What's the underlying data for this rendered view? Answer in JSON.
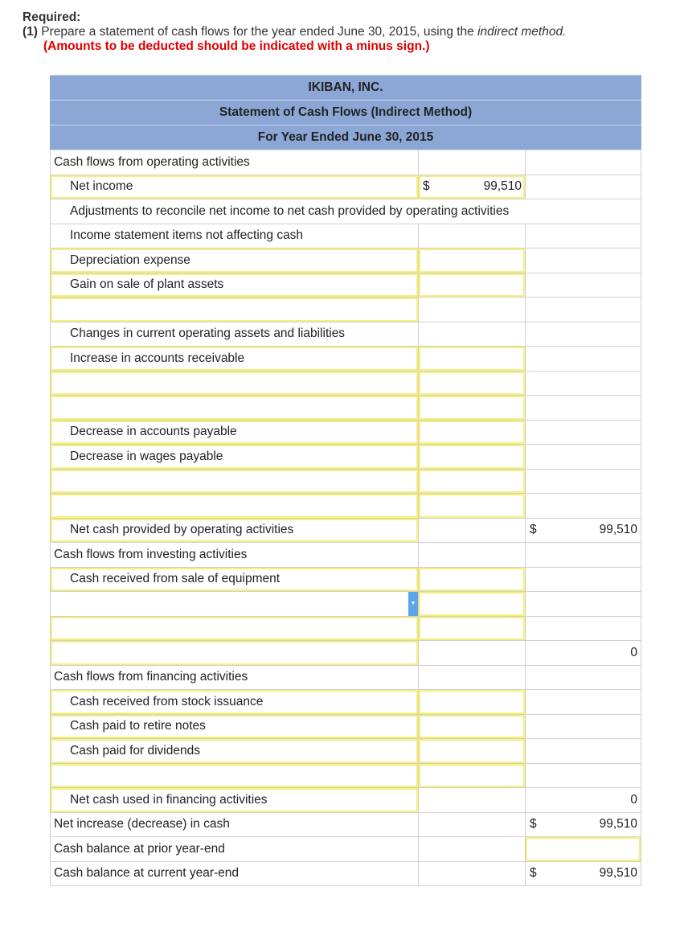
{
  "instructions": {
    "title": "Required:",
    "number": "(1)",
    "text_before": " Prepare a statement of cash flows for the year ended June 30, 2015, using the ",
    "text_italic": "indirect method.",
    "note": "(Amounts to be deducted should be indicated with a minus sign.)"
  },
  "statement": {
    "company": "IKIBAN, INC.",
    "title": "Statement of Cash Flows (Indirect Method)",
    "period": "For Year Ended June 30, 2015",
    "currency_symbol": "$",
    "rows": [
      {
        "label": "Cash flows from operating activities",
        "indent": false,
        "label_input": false,
        "col2": "",
        "col2_input": false,
        "col3": ""
      },
      {
        "label": "Net income",
        "indent": true,
        "label_input": true,
        "col2": "99,510",
        "col2_dollar": true,
        "col2_input": true,
        "col3": ""
      },
      {
        "label": "Adjustments to reconcile net income to net cash provided by operating activities",
        "indent": true,
        "span": true
      },
      {
        "label": "Income statement items not affecting cash",
        "indent": true,
        "label_input": false,
        "col2": "",
        "col2_input": false,
        "col3": ""
      },
      {
        "label": "Depreciation expense",
        "indent": true,
        "label_input": true,
        "col2": "",
        "col2_input": true,
        "col3": ""
      },
      {
        "label": "Gain on sale of plant assets",
        "indent": true,
        "label_input": true,
        "col2": "",
        "col2_input": true,
        "col3": ""
      },
      {
        "label": "",
        "indent": true,
        "label_input": true,
        "col2": "",
        "col2_input": false,
        "col3": ""
      },
      {
        "label": "Changes in current operating assets and liabilities",
        "indent": true,
        "label_input": false,
        "col2": "",
        "col2_input": false,
        "col3": ""
      },
      {
        "label": "Increase in accounts receivable",
        "indent": true,
        "label_input": true,
        "col2": "",
        "col2_input": true,
        "col3": ""
      },
      {
        "label": "",
        "indent": true,
        "label_input": true,
        "col2": "",
        "col2_input": true,
        "col3": ""
      },
      {
        "label": "",
        "indent": true,
        "label_input": true,
        "col2": "",
        "col2_input": true,
        "col3": ""
      },
      {
        "label": "Decrease in accounts payable",
        "indent": true,
        "label_input": true,
        "col2": "",
        "col2_input": true,
        "col3": ""
      },
      {
        "label": "Decrease in wages payable",
        "indent": true,
        "label_input": true,
        "col2": "",
        "col2_input": true,
        "col3": ""
      },
      {
        "label": "",
        "indent": true,
        "label_input": true,
        "col2": "",
        "col2_input": true,
        "col3": ""
      },
      {
        "label": "",
        "indent": true,
        "label_input": true,
        "col2": "",
        "col2_input": true,
        "col3": ""
      },
      {
        "label": "Net cash provided by operating activities",
        "indent": true,
        "label_input": true,
        "col2": "",
        "col2_input": false,
        "col2_topline": true,
        "col3": "99,510",
        "col3_dollar": true
      },
      {
        "label": "Cash flows from investing activities",
        "indent": false,
        "label_input": false,
        "col2": "",
        "col2_input": false,
        "col3": ""
      },
      {
        "label": "Cash received from sale of equipment",
        "indent": true,
        "label_input": true,
        "col2": "",
        "col2_input": true,
        "col3": ""
      },
      {
        "label": "",
        "indent": true,
        "label_input": true,
        "dropdown": true,
        "col2": "",
        "col2_input": true,
        "col3": ""
      },
      {
        "label": "",
        "indent": true,
        "label_input": true,
        "col2": "",
        "col2_input": true,
        "col3": ""
      },
      {
        "label": "",
        "indent": true,
        "label_input": true,
        "col2": "",
        "col2_input": false,
        "col2_topline": true,
        "col3": "0"
      },
      {
        "label": "Cash flows from financing activities",
        "indent": false,
        "label_input": false,
        "col2": "",
        "col2_input": false,
        "col3": ""
      },
      {
        "label": "Cash received from stock issuance",
        "indent": true,
        "label_input": true,
        "col2": "",
        "col2_input": true,
        "col3": ""
      },
      {
        "label": "Cash paid to retire notes",
        "indent": true,
        "label_input": true,
        "col2": "",
        "col2_input": true,
        "col3": ""
      },
      {
        "label": "Cash paid for dividends",
        "indent": true,
        "label_input": true,
        "col2": "",
        "col2_input": true,
        "col3": ""
      },
      {
        "label": "",
        "indent": true,
        "label_input": true,
        "col2": "",
        "col2_input": true,
        "col3": ""
      },
      {
        "label": "Net cash used in financing activities",
        "indent": true,
        "label_input": true,
        "col2": "",
        "col2_input": false,
        "col2_topline": true,
        "col3": "0"
      },
      {
        "label": "Net increase (decrease) in cash",
        "indent": false,
        "label_input": false,
        "col2": "",
        "col2_input": false,
        "col3": "99,510",
        "col3_dollar": true,
        "col3_topline": true
      },
      {
        "label": "Cash balance at prior year-end",
        "indent": false,
        "label_input": false,
        "col2": "",
        "col2_input": false,
        "col3": "",
        "col3_input": true
      },
      {
        "label": "Cash balance at current year-end",
        "indent": false,
        "label_input": false,
        "col2": "",
        "col2_input": false,
        "col3": "99,510",
        "col3_dollar": true,
        "col3_double": true
      }
    ]
  }
}
